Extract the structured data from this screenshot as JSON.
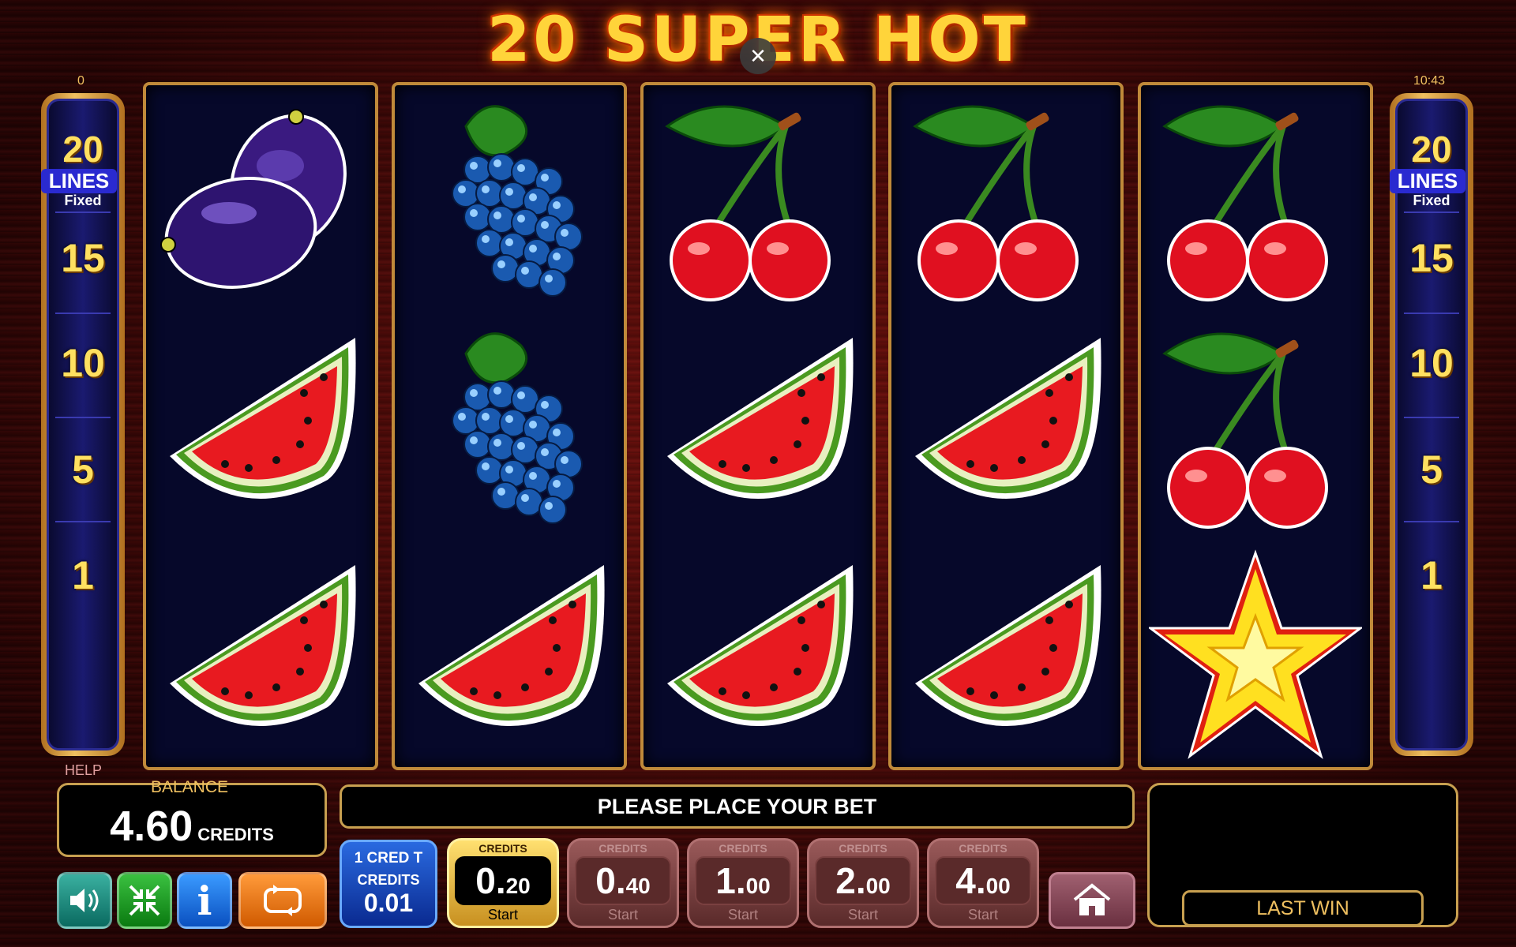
{
  "game": {
    "title": "20 SUPER HOT",
    "close_glyph": "✕",
    "top_left_counter": "0",
    "clock": "10:43"
  },
  "line_panels": {
    "lines_count": "20",
    "lines_word": "LINES",
    "fixed_word": "Fixed",
    "markers": [
      "15",
      "10",
      "5",
      "1"
    ]
  },
  "reels": [
    {
      "symbols": [
        "plum",
        "watermelon",
        "watermelon"
      ]
    },
    {
      "symbols": [
        "grapes",
        "grapes",
        "watermelon"
      ]
    },
    {
      "symbols": [
        "cherry",
        "watermelon",
        "watermelon"
      ]
    },
    {
      "symbols": [
        "cherry",
        "watermelon",
        "watermelon"
      ]
    },
    {
      "symbols": [
        "cherry",
        "cherry",
        "star"
      ]
    }
  ],
  "bottom": {
    "help_label": "HELP",
    "balance_label": "BALANCE",
    "balance_value": "4.60",
    "balance_unit": "CREDITS",
    "message": "PLEASE PLACE YOUR BET",
    "last_win_label": "LAST WIN",
    "credit_info": {
      "line1": "1 CRED T",
      "line2": "CREDITS",
      "value": "0.01"
    },
    "bets": [
      {
        "caption": "CREDITS",
        "int": "0.",
        "dec": "20",
        "start": "Start",
        "active": true
      },
      {
        "caption": "CREDITS",
        "int": "0.",
        "dec": "40",
        "start": "Start",
        "active": false
      },
      {
        "caption": "CREDITS",
        "int": "1.",
        "dec": "00",
        "start": "Start",
        "active": false
      },
      {
        "caption": "CREDITS",
        "int": "2.",
        "dec": "00",
        "start": "Start",
        "active": false
      },
      {
        "caption": "CREDITS",
        "int": "4.",
        "dec": "00",
        "start": "Start",
        "active": false
      }
    ],
    "info_glyph": "i",
    "icons": {
      "sound": "speaker-icon",
      "fullscreen": "fullscreen-exit-icon",
      "info": "info-icon",
      "autoplay": "autoplay-icon",
      "home": "home-icon"
    }
  },
  "colors": {
    "title_gold": "#ffd43a",
    "reel_bg": "#06082a",
    "frame_gold": "#c8a050"
  }
}
